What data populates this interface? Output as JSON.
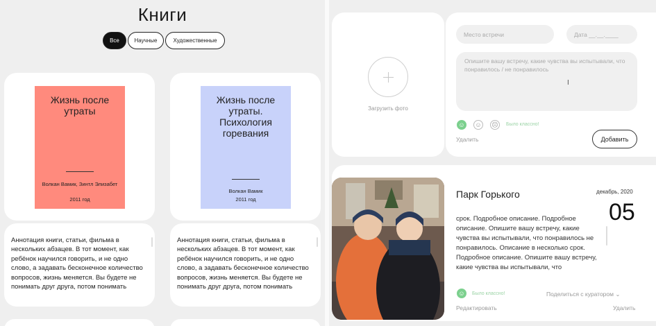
{
  "books_page": {
    "title": "Книги",
    "filters": [
      {
        "label": "Все",
        "active": true
      },
      {
        "label": "Научные",
        "active": false
      },
      {
        "label": "Художественные",
        "active": false
      }
    ],
    "books": [
      {
        "cover_title": "Жизнь после утраты",
        "author": "Волкан Вамик, Зинтл Элизабет",
        "year": "2011 год",
        "cover_color": "#ff8a7d",
        "annotation": "Аннотация книги, статьи, фильма в нескольких абзацев. В тот момент, как ребёнок научился говорить, и не одно слово, а задавать бесконечное количество вопросов, жизнь меняется. Вы будете не понимать друг друга, потом понимать"
      },
      {
        "cover_title": "Жизнь после утраты. Психология горевания",
        "author": "Волкан Вамик",
        "year": "2011 год",
        "cover_color": "#c8d2fa",
        "annotation": "Аннотация книги, статьи, фильма в нескольких абзацев. В тот момент, как ребёнок научился говорить, и не одно слово, а задавать бесконечное количество вопросов, жизнь меняется. Вы будете не понимать друг друга, потом понимать"
      }
    ]
  },
  "meeting_form": {
    "upload_label": "Загрузить фото",
    "place_placeholder": "Место встречи",
    "date_placeholder": "Дата __.__.____",
    "text_placeholder": "Опишите вашу встречу, какие чувства вы испытывали, что понравилось / не понравилось",
    "mood_note": "Было классно!",
    "delete_label": "Удалить",
    "add_button": "Добавить"
  },
  "meeting_card": {
    "title": "Парк Горького",
    "month_year": "декабрь, 2020",
    "day": "05",
    "description": "срок. Подробное описание. Подробное описание. Опишите вашу встречу, какие чувства вы испытывали, что понравилось не понравилось. Описание в несколько срок. Подробное описание. Опишите вашу встречу, какие чувства вы испытывали, что",
    "mood_note": "Было классно!",
    "share_label": "Поделиться с куратором",
    "edit_label": "Редактировать",
    "delete_label": "Удалить"
  },
  "colors": {
    "accent_green": "#7cd08e"
  }
}
